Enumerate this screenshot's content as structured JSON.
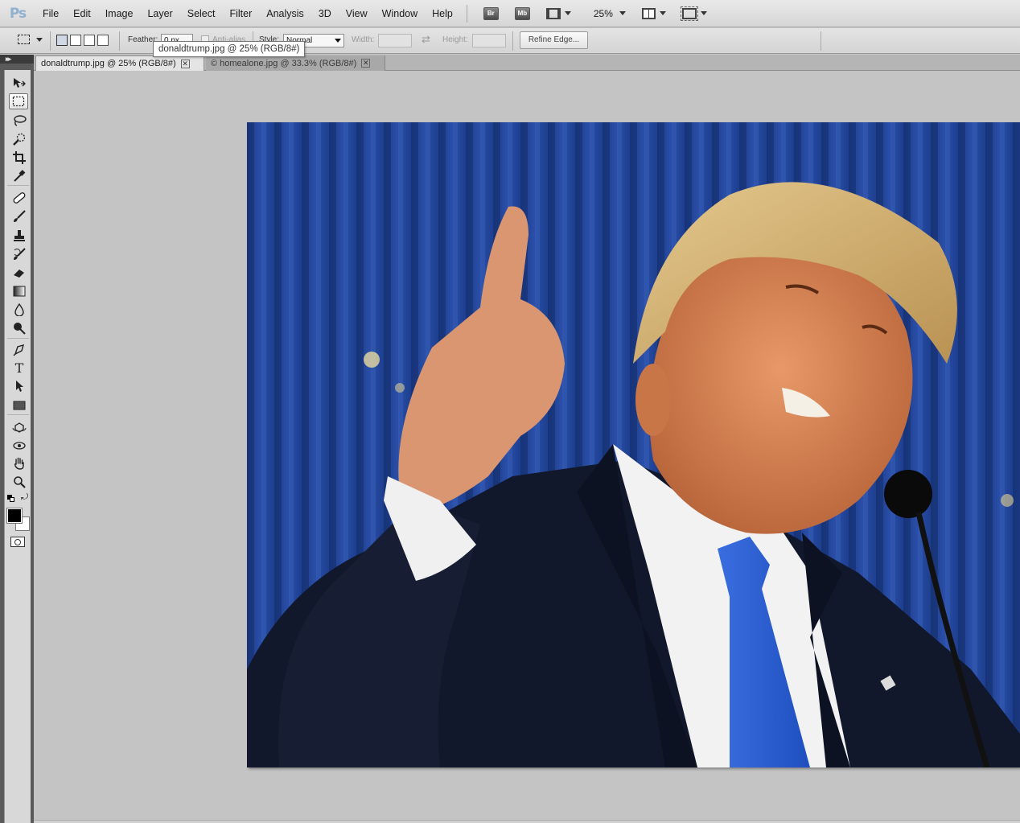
{
  "app": {
    "logo": "Ps"
  },
  "menu": {
    "items": [
      "File",
      "Edit",
      "Image",
      "Layer",
      "Select",
      "Filter",
      "Analysis",
      "3D",
      "View",
      "Window",
      "Help"
    ],
    "bridge_label": "Br",
    "minibridge_label": "Mb",
    "zoom": "25%"
  },
  "options": {
    "feather_label": "Feather:",
    "feather_value": "0 px",
    "antialias_label": "Anti-alias",
    "style_label": "Style:",
    "style_value": "Normal",
    "width_label": "Width:",
    "height_label": "Height:",
    "refine_edge_label": "Refine Edge..."
  },
  "tooltip": "donaldtrump.jpg @ 25% (RGB/8#)",
  "tabs": [
    {
      "label": "donaldtrump.jpg @ 25% (RGB/8#)",
      "active": true
    },
    {
      "label": "© homealone.jpg @ 33.3% (RGB/8#)",
      "active": false
    }
  ],
  "tools": [
    {
      "name": "move-tool",
      "icon": "move-icon"
    },
    {
      "name": "rectangular-marquee-tool",
      "icon": "marquee-icon"
    },
    {
      "name": "lasso-tool",
      "icon": "lasso-icon"
    },
    {
      "name": "quick-selection-tool",
      "icon": "quick-select-icon"
    },
    {
      "name": "crop-tool",
      "icon": "crop-icon"
    },
    {
      "name": "eyedropper-tool",
      "icon": "eyedropper-icon"
    },
    {
      "name": "healing-brush-tool",
      "icon": "healing-icon"
    },
    {
      "name": "brush-tool",
      "icon": "brush-icon"
    },
    {
      "name": "clone-stamp-tool",
      "icon": "stamp-icon"
    },
    {
      "name": "history-brush-tool",
      "icon": "history-brush-icon"
    },
    {
      "name": "eraser-tool",
      "icon": "eraser-icon"
    },
    {
      "name": "gradient-tool",
      "icon": "gradient-icon"
    },
    {
      "name": "blur-tool",
      "icon": "blur-icon"
    },
    {
      "name": "dodge-tool",
      "icon": "dodge-icon"
    },
    {
      "name": "pen-tool",
      "icon": "pen-icon"
    },
    {
      "name": "type-tool",
      "icon": "type-icon"
    },
    {
      "name": "path-selection-tool",
      "icon": "path-select-icon"
    },
    {
      "name": "rectangle-tool",
      "icon": "rectangle-icon"
    },
    {
      "name": "3d-rotate-tool",
      "icon": "3d-rotate-icon"
    },
    {
      "name": "3d-orbit-tool",
      "icon": "3d-orbit-icon"
    },
    {
      "name": "hand-tool",
      "icon": "hand-icon"
    },
    {
      "name": "zoom-tool",
      "icon": "zoom-icon"
    }
  ],
  "type_tool_glyph": "T",
  "colors": {
    "foreground": "#000000",
    "background": "#ffffff"
  },
  "document": {
    "filename": "donaldtrump.jpg"
  }
}
